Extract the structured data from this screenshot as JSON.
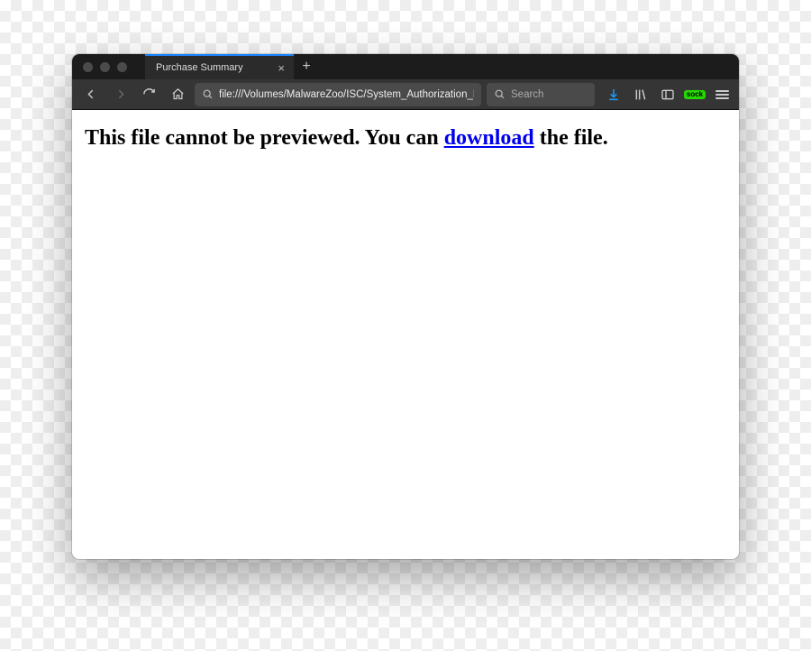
{
  "tab": {
    "title": "Purchase Summary"
  },
  "address": {
    "url": "file:///Volumes/MalwareZoo/ISC/System_Authorization_Form"
  },
  "search": {
    "placeholder": "Search"
  },
  "badge": {
    "label": "sock"
  },
  "page": {
    "text_before": "This file cannot be previewed. You can ",
    "link_text": "download",
    "text_after": " the file."
  }
}
